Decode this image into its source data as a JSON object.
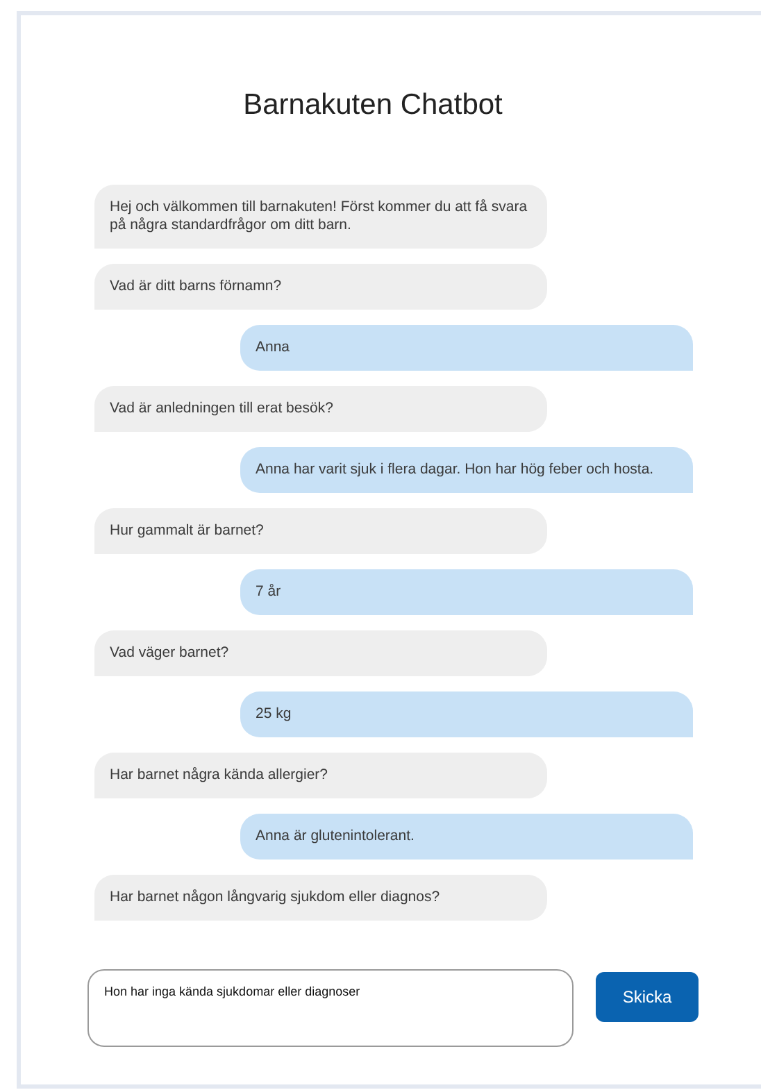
{
  "title": "Barnakuten Chatbot",
  "messages": [
    {
      "kind": "bot",
      "text": "Hej och välkommen till barnakuten! Först kommer du att få svara på några standardfrågor om ditt barn."
    },
    {
      "kind": "bot",
      "text": "Vad är ditt barns förnamn?"
    },
    {
      "kind": "user",
      "text": "Anna"
    },
    {
      "kind": "bot",
      "text": "Vad är anledningen till erat besök?"
    },
    {
      "kind": "user",
      "text": "Anna har varit sjuk i flera dagar. Hon har hög feber och hosta."
    },
    {
      "kind": "bot",
      "text": "Hur gammalt är barnet?"
    },
    {
      "kind": "user",
      "text": "7 år"
    },
    {
      "kind": "bot",
      "text": "Vad väger barnet?"
    },
    {
      "kind": "user",
      "text": "25 kg"
    },
    {
      "kind": "bot",
      "text": "Har barnet några kända allergier?"
    },
    {
      "kind": "user",
      "text": "Anna är glutenintolerant."
    },
    {
      "kind": "bot",
      "text": "Har barnet någon långvarig sjukdom eller diagnos?"
    }
  ],
  "input": {
    "value": "Hon har inga kända sjukdomar eller diagnoser"
  },
  "send_button": {
    "label": "Skicka"
  }
}
